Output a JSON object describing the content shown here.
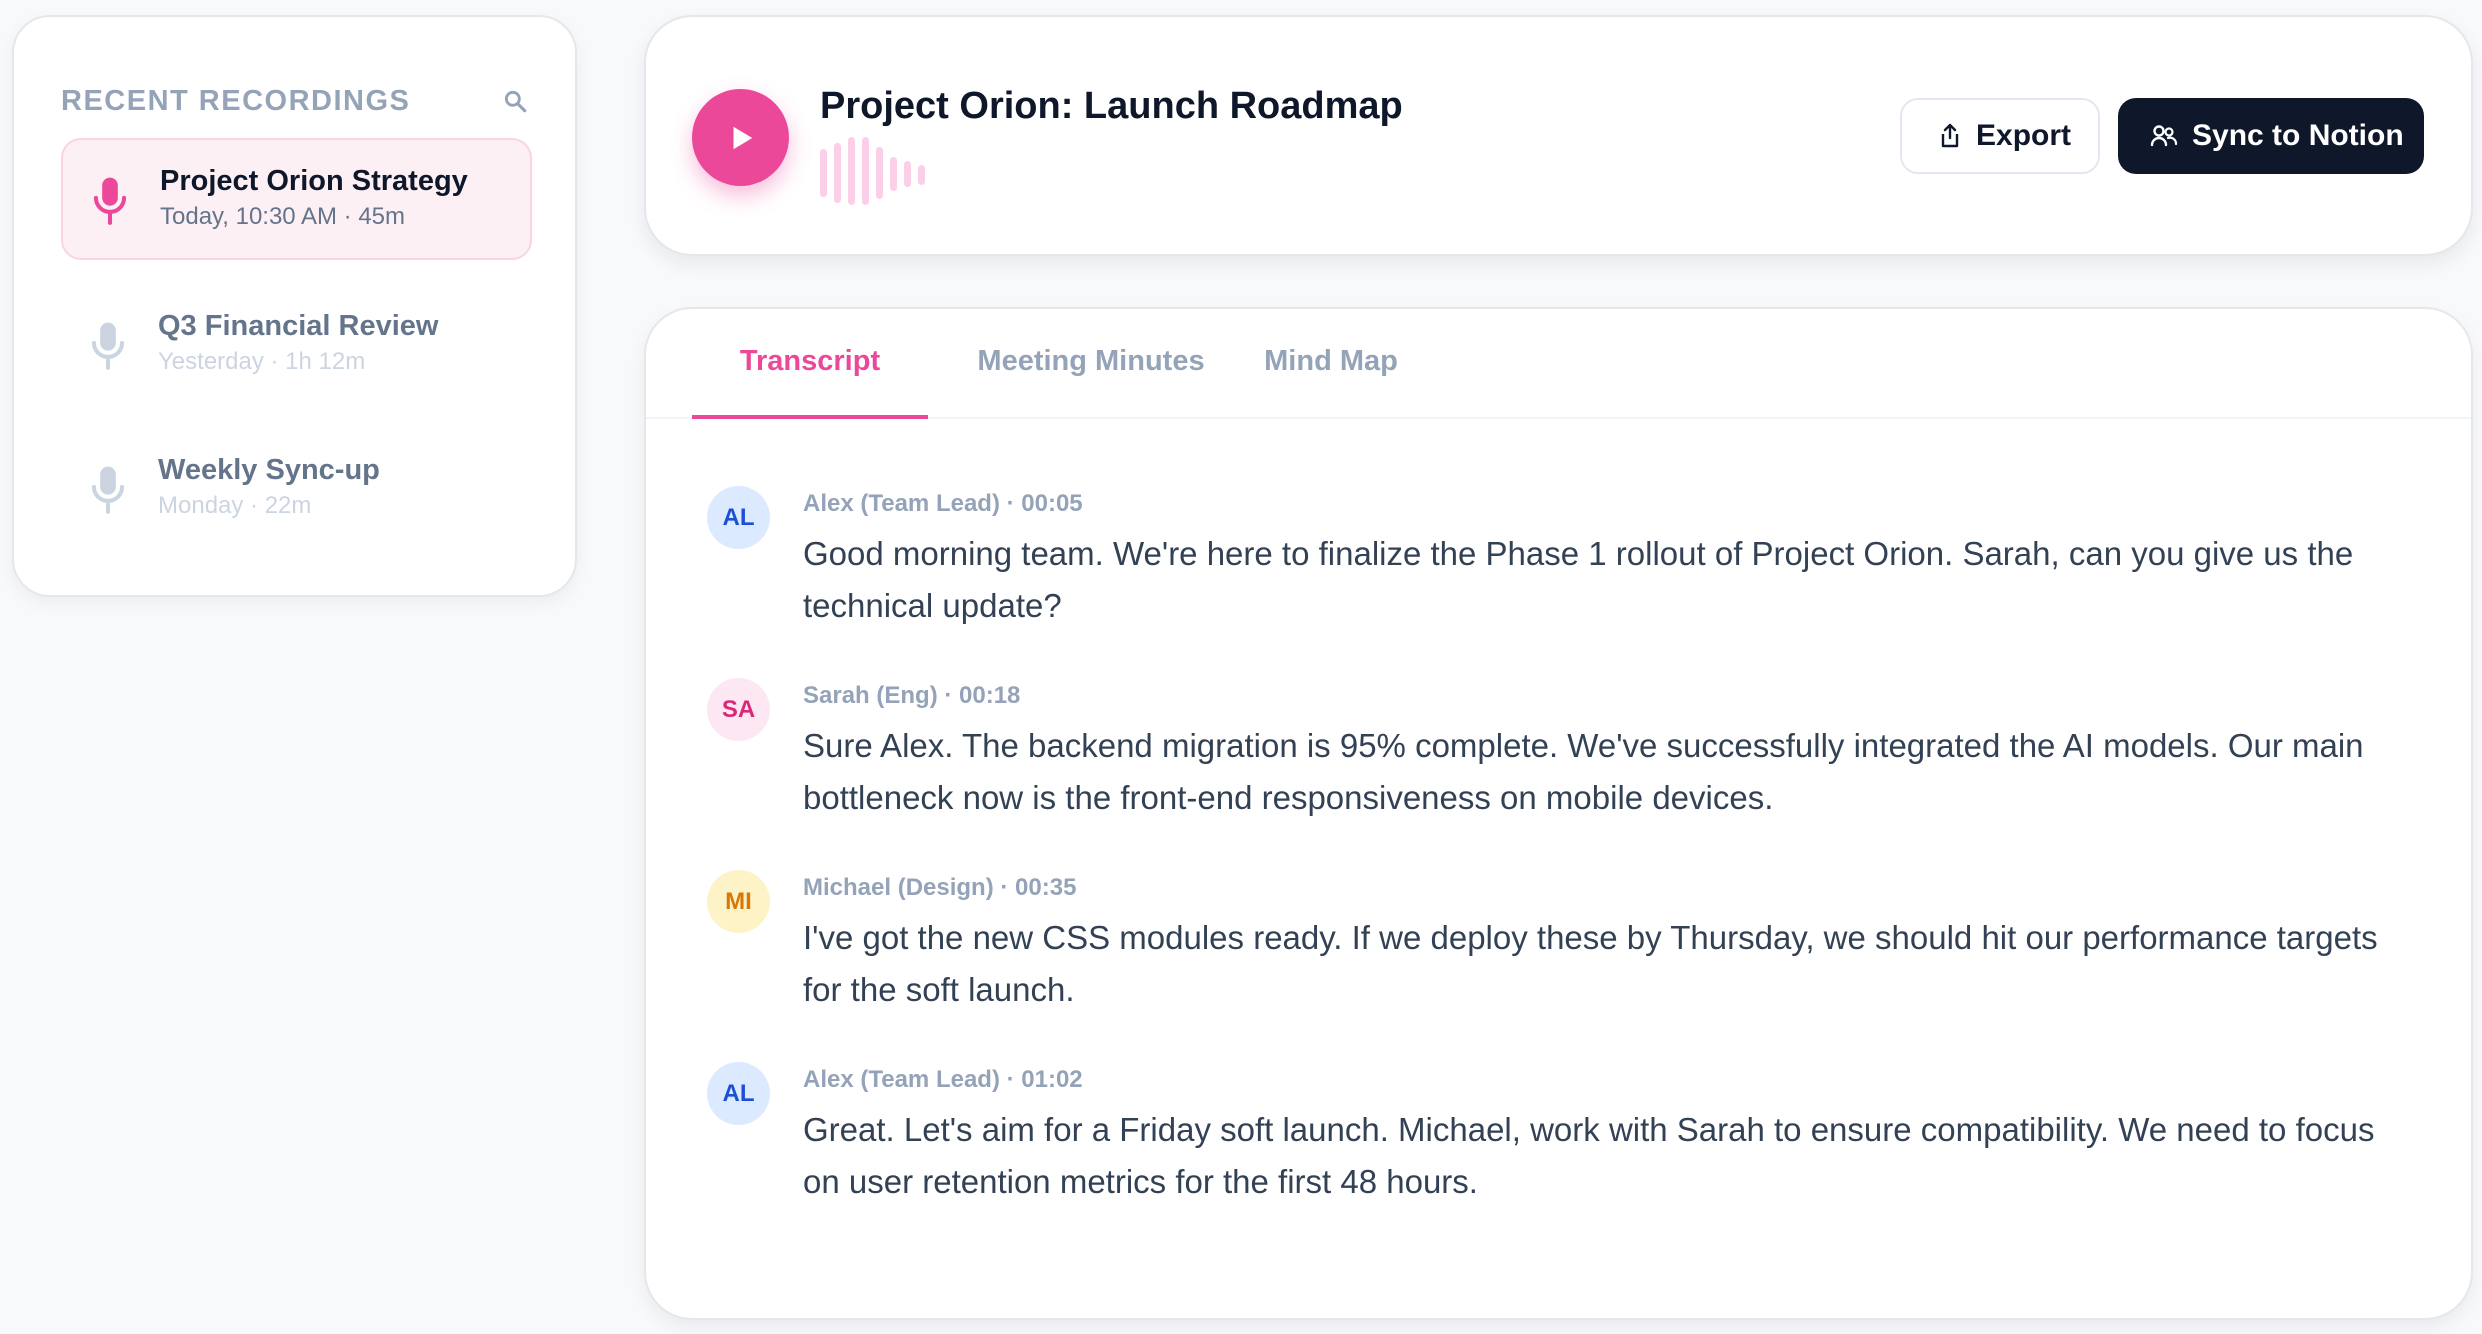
{
  "sidebar": {
    "title": "RECENT RECORDINGS",
    "search_icon": "search-icon",
    "items": [
      {
        "title": "Project Orion Strategy",
        "meta": "Today, 10:30 AM · 45m",
        "active": true
      },
      {
        "title": "Q3 Financial Review",
        "meta": "Yesterday · 1h 12m",
        "active": false
      },
      {
        "title": "Weekly Sync-up",
        "meta": "Monday · 22m",
        "active": false
      }
    ]
  },
  "player": {
    "title": "Project Orion: Launch Roadmap",
    "play_icon": "play-icon",
    "export_label": "Export",
    "sync_label": "Sync to Notion"
  },
  "tabs": [
    {
      "label": "Transcript",
      "active": true
    },
    {
      "label": "Meeting Minutes",
      "active": false
    },
    {
      "label": "Mind Map",
      "active": false
    }
  ],
  "transcript": [
    {
      "initials": "AL",
      "header": "Alex (Team Lead) · 00:05",
      "text": "Good morning team. We're here to finalize the Phase 1 rollout of Project Orion. Sarah, can you give us the technical update?"
    },
    {
      "initials": "SA",
      "header": "Sarah (Eng) · 00:18",
      "text": "Sure Alex. The backend migration is 95% complete. We've successfully integrated the AI models. Our main bottleneck now is the front-end responsiveness on mobile devices."
    },
    {
      "initials": "MI",
      "header": "Michael (Design) · 00:35",
      "text": "I've got the new CSS modules ready. If we deploy these by Thursday, we should hit our performance targets for the soft launch."
    },
    {
      "initials": "AL",
      "header": "Alex (Team Lead) · 01:02",
      "text": "Great. Let's aim for a Friday soft launch. Michael, work with Sarah to ensure compatibility. We need to focus on user retention metrics for the first 48 hours."
    }
  ],
  "colors": {
    "accent": "#ec4899",
    "dark": "#0f172a",
    "avatar_blue": "#dbeafe",
    "avatar_pink": "#fce7f3",
    "avatar_amber": "#fef3c7"
  }
}
